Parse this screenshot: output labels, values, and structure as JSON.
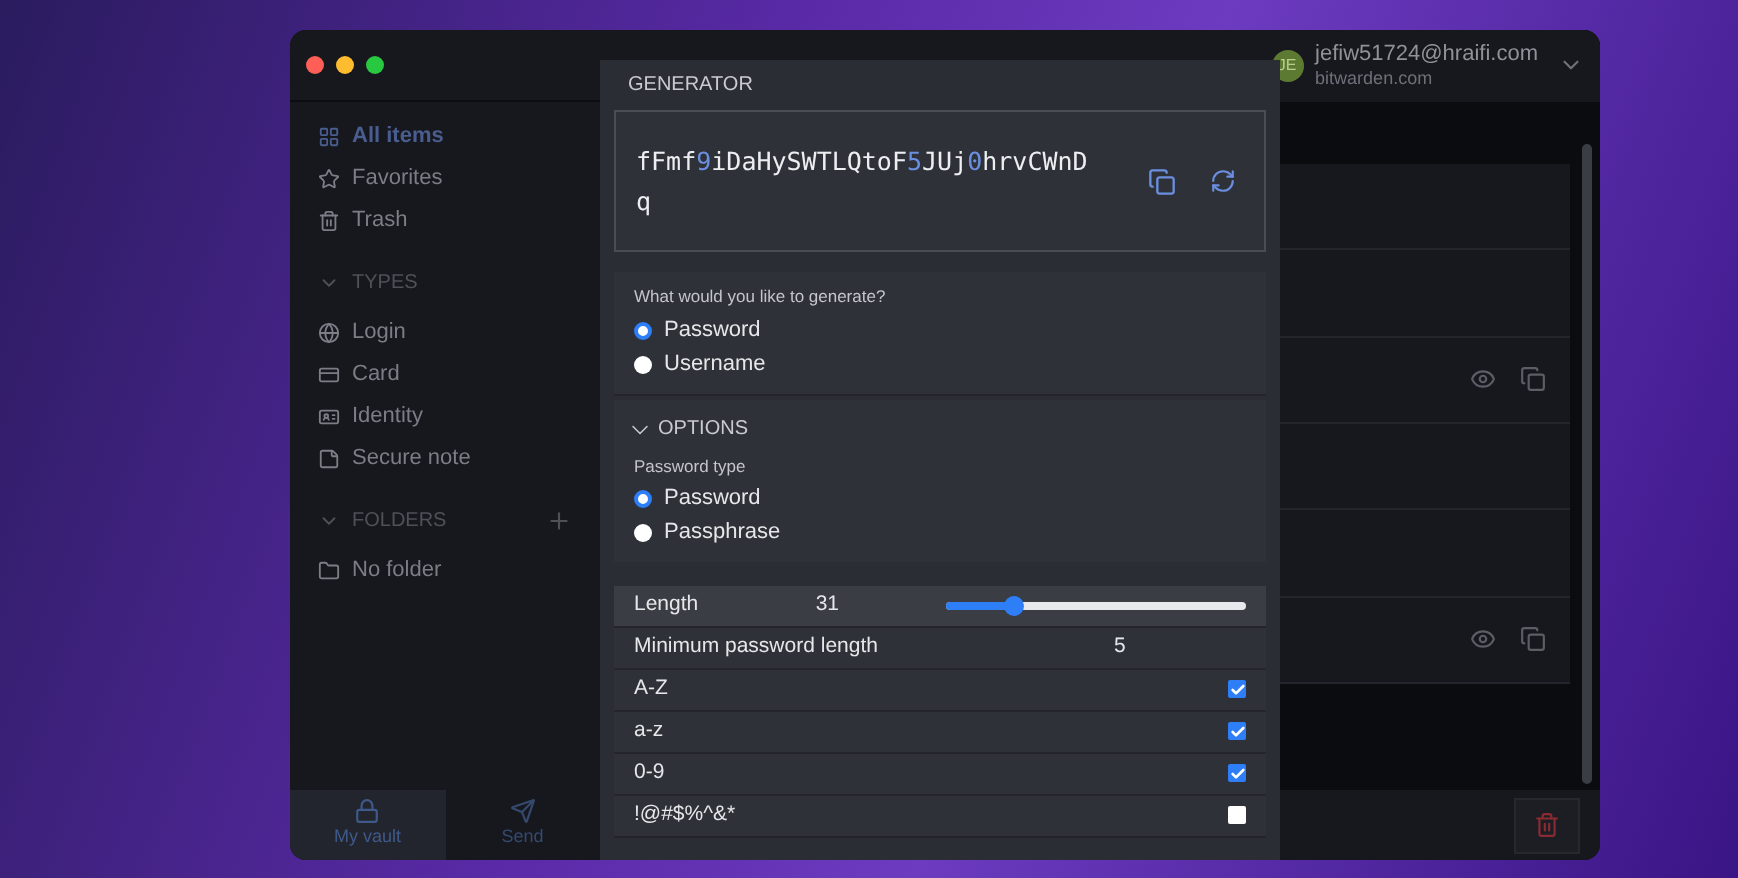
{
  "sidebar": {
    "items": [
      {
        "label": "All items",
        "selected": true
      },
      {
        "label": "Favorites",
        "selected": false
      },
      {
        "label": "Trash",
        "selected": false
      }
    ],
    "types_header": "TYPES",
    "types": [
      {
        "label": "Login",
        "selected": false
      },
      {
        "label": "Card",
        "selected": false
      },
      {
        "label": "Identity",
        "selected": false
      },
      {
        "label": "Secure note",
        "selected": false
      }
    ],
    "folders_header": "FOLDERS",
    "folders": [
      {
        "label": "No folder",
        "selected": false
      }
    ]
  },
  "bottom_nav": [
    {
      "label": "My vault",
      "selected": true
    },
    {
      "label": "Send",
      "selected": false
    }
  ],
  "account": {
    "initials": "JE",
    "email": "jefiw51724@hraifi.com",
    "server": "bitwarden.com"
  },
  "generator": {
    "title": "GENERATOR",
    "password": [
      {
        "kind": "letters",
        "text": "fFmf"
      },
      {
        "kind": "digit",
        "text": "9"
      },
      {
        "kind": "letters",
        "text": "iDaHySWTLQtoF"
      },
      {
        "kind": "digit",
        "text": "5"
      },
      {
        "kind": "letters",
        "text": "JUj"
      },
      {
        "kind": "digit",
        "text": "0"
      },
      {
        "kind": "letters",
        "text": "hrvCWnD"
      },
      {
        "kind": "letters",
        "text": "q"
      }
    ],
    "question": "What would you like to generate?",
    "generate_options": [
      {
        "label": "Password",
        "selected": true
      },
      {
        "label": "Username",
        "selected": false
      }
    ],
    "options_header": "OPTIONS",
    "options_expanded": true,
    "password_type_label": "Password type",
    "password_types": [
      {
        "label": "Password",
        "selected": true
      },
      {
        "label": "Passphrase",
        "selected": false
      }
    ],
    "settings": [
      {
        "kind": "slider",
        "label": "Length",
        "value": "31",
        "level": 0.23
      },
      {
        "kind": "number",
        "label": "Minimum password length",
        "value": "5"
      },
      {
        "kind": "checkbox",
        "label": "A-Z",
        "checked": true
      },
      {
        "kind": "checkbox",
        "label": "a-z",
        "checked": true
      },
      {
        "kind": "checkbox",
        "label": "0-9",
        "checked": true
      },
      {
        "kind": "checkbox",
        "label": "!@#$%^&*",
        "checked": false
      }
    ]
  }
}
